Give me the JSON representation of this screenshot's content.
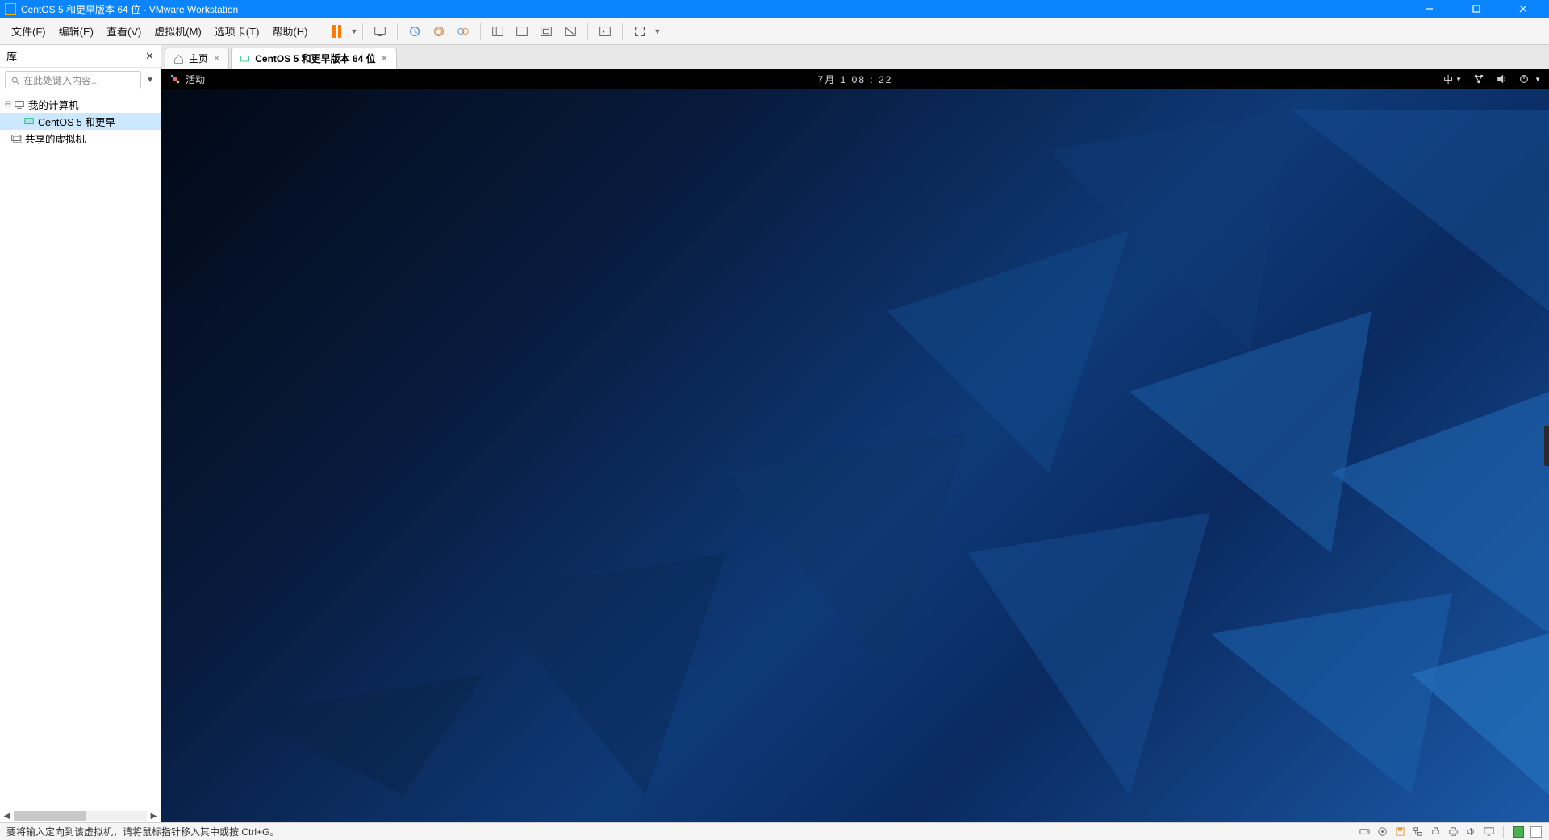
{
  "window": {
    "title": "CentOS 5 和更早版本 64 位 - VMware Workstation"
  },
  "menu": {
    "file": "文件(F)",
    "edit": "编辑(E)",
    "view": "查看(V)",
    "vm": "虚拟机(M)",
    "tabs": "选项卡(T)",
    "help": "帮助(H)"
  },
  "sidebar": {
    "title": "库",
    "search_placeholder": "在此处键入内容...",
    "tree": {
      "my_computer": "我的计算机",
      "centos": "CentOS 5 和更早",
      "shared": "共享的虚拟机"
    }
  },
  "tabs": {
    "home": "主页",
    "centos": "CentOS 5 和更早版本 64 位"
  },
  "gnome": {
    "activities": "活动",
    "clock": "7月 1  08 : 22",
    "ime": "中"
  },
  "statusbar": {
    "message": "要将输入定向到该虚拟机，请将鼠标指针移入其中或按 Ctrl+G。"
  }
}
